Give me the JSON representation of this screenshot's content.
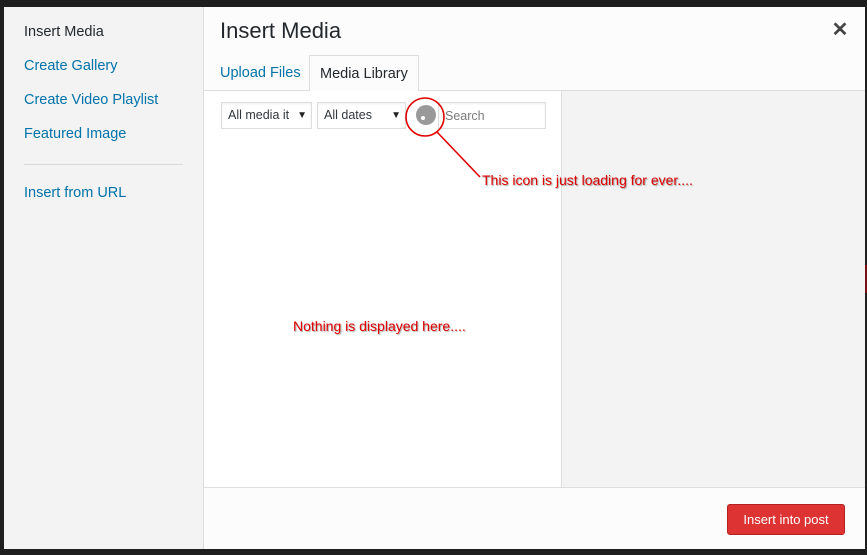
{
  "menu": {
    "items": [
      {
        "label": "Insert Media",
        "active": true
      },
      {
        "label": "Create Gallery"
      },
      {
        "label": "Create Video Playlist"
      },
      {
        "label": "Featured Image"
      },
      {
        "label": "Insert from URL"
      }
    ]
  },
  "header": {
    "title": "Insert Media",
    "close_icon": "close-icon",
    "close_glyph": "✕"
  },
  "tabs": [
    {
      "label": "Upload Files"
    },
    {
      "label": "Media Library",
      "active": true
    }
  ],
  "filters": {
    "type_select": "All media it",
    "date_select": "All dates",
    "arrow_glyph": "▼",
    "search_placeholder": "Search"
  },
  "toolbar": {
    "insert_label": "Insert into post"
  },
  "annotations": {
    "loading_note": "This icon is just loading for ever....",
    "empty_note": "Nothing is displayed here...."
  },
  "colors": {
    "link": "#0073aa",
    "primary_button": "#dd3333",
    "annotation": "#e00000"
  }
}
